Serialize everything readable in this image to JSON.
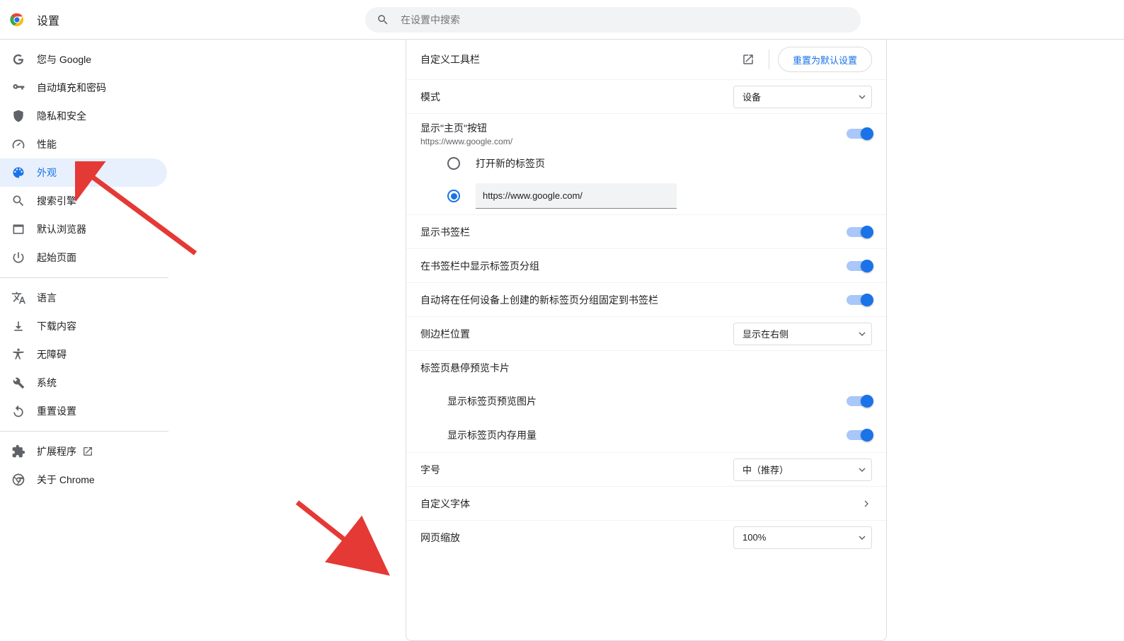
{
  "header": {
    "title": "设置",
    "search_placeholder": "在设置中搜索"
  },
  "sidebar": {
    "items": [
      {
        "label": "您与 Google"
      },
      {
        "label": "自动填充和密码"
      },
      {
        "label": "隐私和安全"
      },
      {
        "label": "性能"
      },
      {
        "label": "外观"
      },
      {
        "label": "搜索引擎"
      },
      {
        "label": "默认浏览器"
      },
      {
        "label": "起始页面"
      }
    ],
    "items2": [
      {
        "label": "语言"
      },
      {
        "label": "下载内容"
      },
      {
        "label": "无障碍"
      },
      {
        "label": "系统"
      },
      {
        "label": "重置设置"
      }
    ],
    "items3": [
      {
        "label": "扩展程序"
      },
      {
        "label": "关于 Chrome"
      }
    ]
  },
  "panel": {
    "toolbar_title": "自定义工具栏",
    "reset_button": "重置为默认设置",
    "mode_label": "模式",
    "mode_value": "设备",
    "home_button_label": "显示\"主页\"按钮",
    "home_button_sub": "https://www.google.com/",
    "radio_newtab": "打开新的标签页",
    "radio_url_value": "https://www.google.com/",
    "bookmarks_label": "显示书签栏",
    "tabgroups_label": "在书签栏中显示标签页分组",
    "autopin_label": "自动将在任何设备上创建的新标签页分组固定到书签栏",
    "sidebar_pos_label": "侧边栏位置",
    "sidebar_pos_value": "显示在右侧",
    "hover_card_label": "标签页悬停预览卡片",
    "hover_image_label": "显示标签页预览图片",
    "hover_mem_label": "显示标签页内存用量",
    "font_label": "字号",
    "font_value": "中（推荐）",
    "custom_font_label": "自定义字体",
    "zoom_label": "网页缩放",
    "zoom_value": "100%"
  }
}
